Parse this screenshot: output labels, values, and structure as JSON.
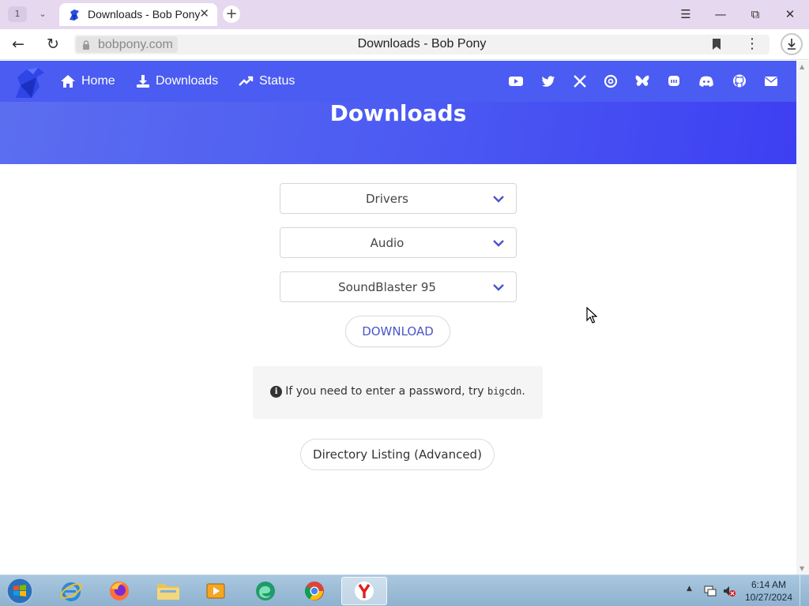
{
  "browser": {
    "tab_count": "1",
    "tab_title": "Downloads - Bob Pony",
    "url": "bobpony.com",
    "page_title": "Downloads - Bob Pony"
  },
  "site": {
    "nav": [
      {
        "label": "Home",
        "icon": "home-icon"
      },
      {
        "label": "Downloads",
        "icon": "download-icon"
      },
      {
        "label": "Status",
        "icon": "trending-up-icon"
      }
    ],
    "socials": [
      "youtube-icon",
      "twitter-icon",
      "x-icon",
      "threads-icon",
      "bluesky-icon",
      "mastodon-icon",
      "discord-icon",
      "github-icon",
      "mail-icon"
    ],
    "hero_title": "Downloads",
    "brand_color": "#4a5cf2"
  },
  "form": {
    "category": "Drivers",
    "subcategory": "Audio",
    "item": "SoundBlaster 95",
    "download_label": "DOWNLOAD",
    "note_text": "If you need to enter a password, try ",
    "note_code": "bigcdn",
    "note_end": ".",
    "directory_label": "Directory Listing (Advanced)"
  },
  "taskbar": {
    "apps": [
      "internet-explorer",
      "firefox",
      "file-explorer",
      "media-player",
      "edge-beta",
      "chrome",
      "yandex-browser"
    ],
    "time": "6:14 AM",
    "date": "10/27/2024"
  }
}
